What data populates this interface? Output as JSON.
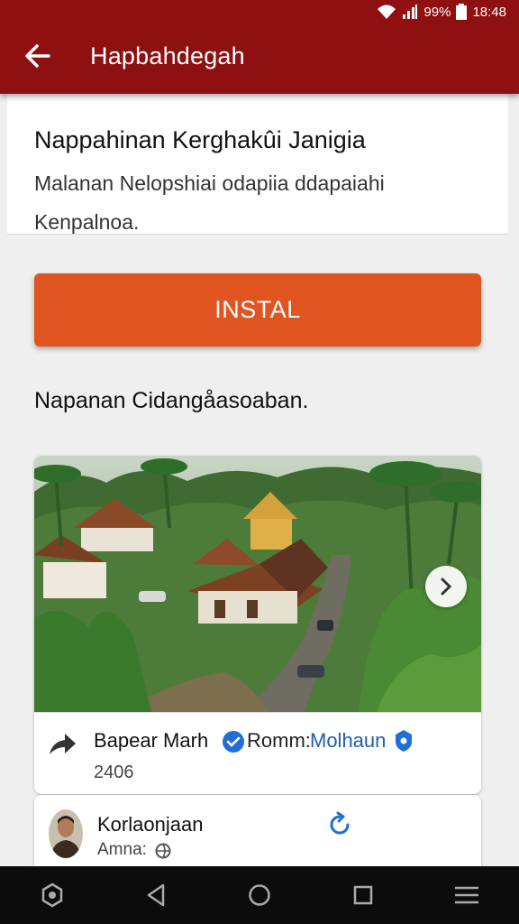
{
  "status_bar": {
    "battery": "99%",
    "time": "18:48"
  },
  "app_bar": {
    "title": "Hapbahdegah"
  },
  "header": {
    "title": "Nappahinan Kerghakûi Janigia",
    "description": "Malanan Nelopshiai odapiia ddapaiahi Kenpalnoa."
  },
  "install_button": {
    "label": "INSTAL"
  },
  "section": {
    "text": "Napanan Cidangåasoaban."
  },
  "media_post": {
    "author": "Bapear Marh",
    "from_label": "Romm:",
    "from_link": "Molhaun",
    "count": "2406"
  },
  "user": {
    "name": "Korlaonjaan",
    "subtitle": "Amna:"
  },
  "colors": {
    "app_bar": "#8e1010",
    "install_button": "#e05420",
    "link": "#1e5fb4",
    "nav_bar": "#0c0c0c"
  },
  "icons": {
    "status": [
      "wifi-icon",
      "signal-icon",
      "battery-icon"
    ],
    "navigation": [
      "assistant-icon",
      "nav-back-icon",
      "home-icon",
      "recents-icon",
      "menu-icon"
    ]
  }
}
